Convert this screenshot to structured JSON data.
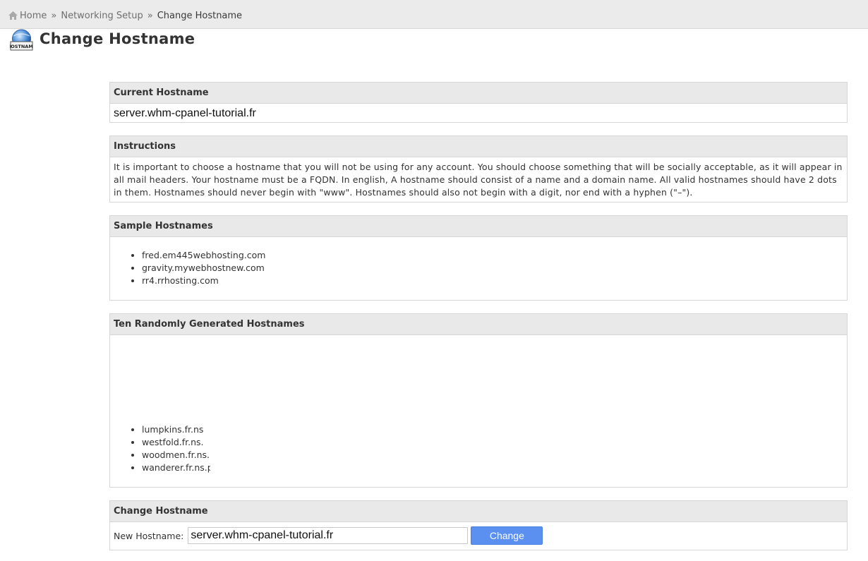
{
  "breadcrumb": {
    "home": "Home",
    "separator": "»",
    "section": "Networking Setup",
    "current": "Change Hostname"
  },
  "page": {
    "title": "Change Hostname",
    "icon_text": "HOSTNAME"
  },
  "current_hostname": {
    "header": "Current Hostname",
    "value": "server.whm-cpanel-tutorial.fr"
  },
  "instructions": {
    "header": "Instructions",
    "text": "It is important to choose a hostname that you will not be using for any account. You should choose something that will be socially acceptable, as it will appear in all mail headers. Your hostname must be a FQDN. In english, A hostname should consist of a name and a domain name. All valid hostnames should have 2 dots in them. Hostnames should never begin with \"www\". Hostnames should also not begin with a digit, nor end with a hyphen (\"–\")."
  },
  "sample_hostnames": {
    "header": "Sample Hostnames",
    "items": [
      "fred.em445webhosting.com",
      "gravity.mywebhostnew.com",
      "rr4.rrhosting.com"
    ]
  },
  "random_hostnames": {
    "header": "Ten Randomly Generated Hostnames",
    "items": [
      "lumpkins.fr.ns",
      "westfold.fr.ns.",
      "woodmen.fr.ns.",
      "wanderer.fr.ns.p"
    ]
  },
  "change_hostname": {
    "header": "Change Hostname",
    "label": "New Hostname:",
    "input_value": "server.whm-cpanel-tutorial.fr",
    "button_label": "Change"
  },
  "colors": {
    "button": "#5b8ff0",
    "panel_header": "#e9e9e9",
    "breadcrumb_bar": "#ebebeb"
  }
}
